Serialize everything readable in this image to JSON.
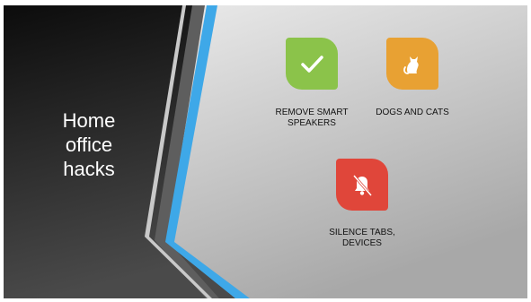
{
  "slide": {
    "title": "Home\noffice\nhacks"
  },
  "items": [
    {
      "label": "REMOVE SMART\nSPEAKERS",
      "icon": "checkmark-icon",
      "color": "#8bc34a"
    },
    {
      "label": "DOGS AND CATS",
      "icon": "cat-icon",
      "color": "#e8a133"
    },
    {
      "label": "SILENCE TABS,\nDEVICES",
      "icon": "bell-off-icon",
      "color": "#e0463a"
    }
  ]
}
